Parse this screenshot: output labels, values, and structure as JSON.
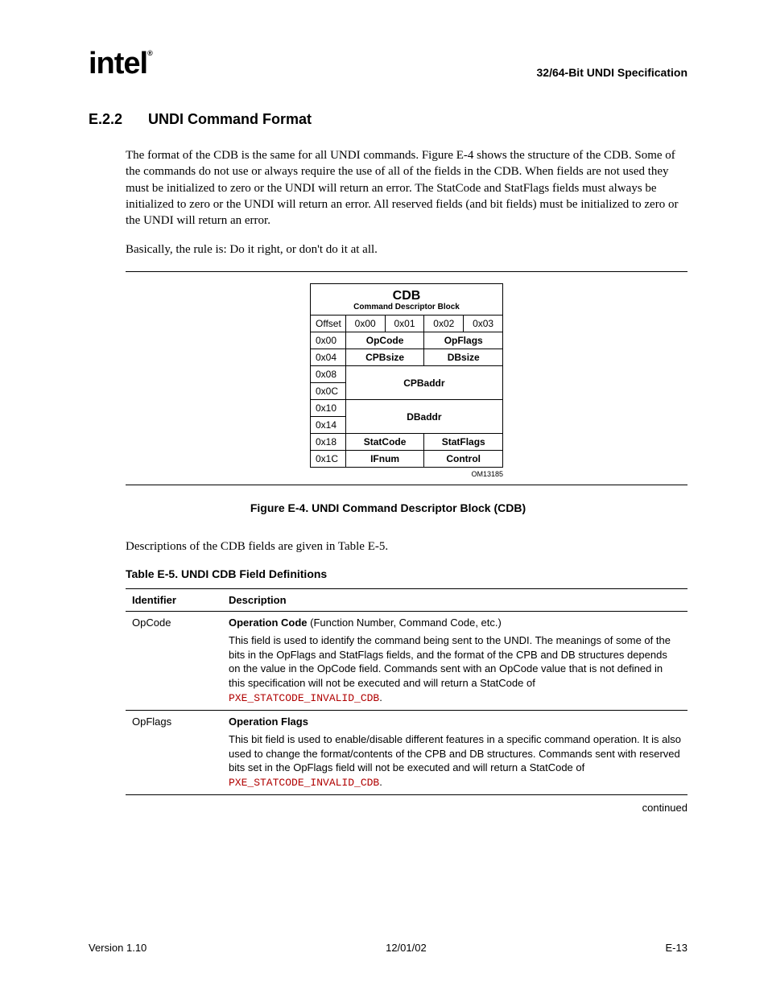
{
  "header": {
    "logo": "intel",
    "reg": "®",
    "spec_title": "32/64-Bit UNDI Specification"
  },
  "section": {
    "number": "E.2.2",
    "title": "UNDI Command Format"
  },
  "paragraphs": {
    "p1": "The format of the CDB is the same for all UNDI commands.  Figure E-4 shows the structure of the CDB.  Some of the commands do not use or always require the use of all of the fields in the CDB.  When fields are not used they must be initialized to zero or the UNDI will return an error.  The StatCode and StatFlags fields must always be initialized to zero or the UNDI will return an error.  All reserved fields (and bit fields) must be initialized to zero or the UNDI will return an error.",
    "p2": "Basically, the rule is:  Do it right, or don't do it at all.",
    "p3": "Descriptions of the CDB fields are given in Table E-5."
  },
  "cdb": {
    "title": "CDB",
    "subtitle": "Command Descriptor Block",
    "cols": {
      "off": "Offset",
      "c0": "0x00",
      "c1": "0x01",
      "c2": "0x02",
      "c3": "0x03"
    },
    "rows": {
      "r00": {
        "off": "0x00",
        "a": "OpCode",
        "b": "OpFlags"
      },
      "r04": {
        "off": "0x04",
        "a": "CPBsize",
        "b": "DBsize"
      },
      "r08": {
        "off": "0x08"
      },
      "r0c": {
        "off": "0x0C"
      },
      "cpbaddr": "CPBaddr",
      "r10": {
        "off": "0x10"
      },
      "r14": {
        "off": "0x14"
      },
      "dbaddr": "DBaddr",
      "r18": {
        "off": "0x18",
        "a": "StatCode",
        "b": "StatFlags"
      },
      "r1c": {
        "off": "0x1C",
        "a": "IFnum",
        "b": "Control"
      }
    },
    "om": "OM13185"
  },
  "figure_caption": "Figure E-4.  UNDI Command Descriptor Block (CDB)",
  "table_caption": "Table E-5.  UNDI CDB Field Definitions",
  "defs": {
    "head": {
      "id": "Identifier",
      "desc": "Description"
    },
    "opcode": {
      "id": "OpCode",
      "title_bold": "Operation Code",
      "title_rest": " (Function Number, Command Code, etc.)",
      "body_pre": "This field is used to identify the command being sent to the UNDI.  The meanings of some of the bits in the OpFlags and StatFlags fields, and the format of the CPB and DB structures depends on the value in the OpCode field.  Commands sent with an OpCode value that is not defined in this specification will not be executed and will return a StatCode of ",
      "const": "PXE_STATCODE_INVALID_CDB",
      "body_post": "."
    },
    "opflags": {
      "id": "OpFlags",
      "title": "Operation Flags",
      "body_pre": "This bit field is used to enable/disable different features in a specific command operation.  It is also used to change the format/contents of the CPB and DB structures.  Commands sent with reserved bits set in the OpFlags field will not be executed and will return a StatCode of ",
      "const": "PXE_STATCODE_INVALID_CDB",
      "body_post": "."
    }
  },
  "continued": "continued",
  "footer": {
    "version": "Version 1.10",
    "date": "12/01/02",
    "page": "E-13"
  },
  "chart_data": {
    "type": "table",
    "title": "CDB — Command Descriptor Block",
    "columns": [
      "Offset",
      "0x00",
      "0x01",
      "0x02",
      "0x03"
    ],
    "rows": [
      {
        "offset": "0x00",
        "bytes01": "OpCode",
        "bytes23": "OpFlags"
      },
      {
        "offset": "0x04",
        "bytes01": "CPBsize",
        "bytes23": "DBsize"
      },
      {
        "offset": "0x08-0x0C",
        "bytes0123": "CPBaddr"
      },
      {
        "offset": "0x10-0x14",
        "bytes0123": "DBaddr"
      },
      {
        "offset": "0x18",
        "bytes01": "StatCode",
        "bytes23": "StatFlags"
      },
      {
        "offset": "0x1C",
        "bytes01": "IFnum",
        "bytes23": "Control"
      }
    ]
  }
}
